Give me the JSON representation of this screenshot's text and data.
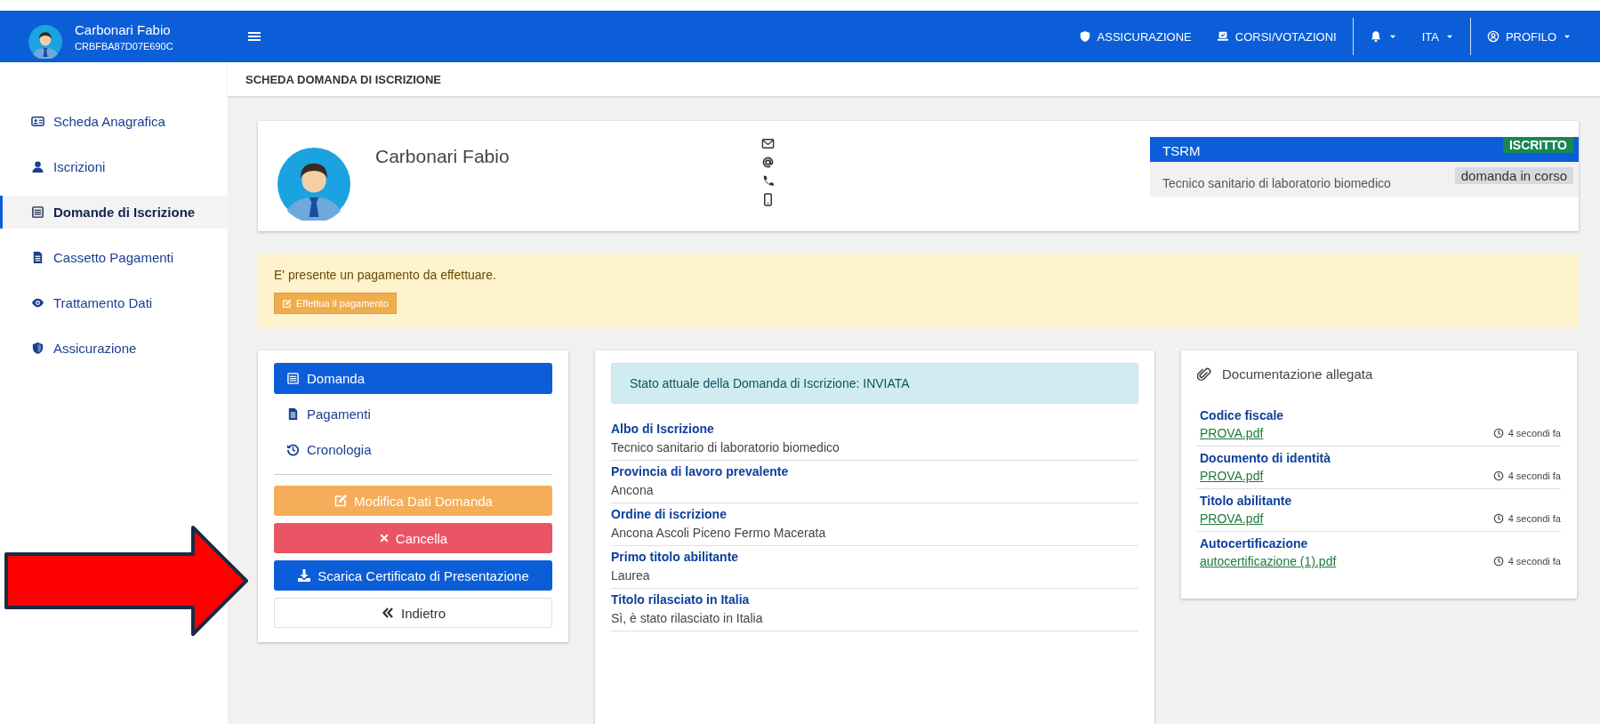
{
  "sidebar": {
    "user": {
      "name": "Carbonari Fabio",
      "code": "CRBFBA87D07E690C"
    },
    "items": [
      {
        "label": "Scheda Anagrafica",
        "selected": false
      },
      {
        "label": "Iscrizioni",
        "selected": false
      },
      {
        "label": "Domande di Iscrizione",
        "selected": true
      },
      {
        "label": "Cassetto Pagamenti",
        "selected": false
      },
      {
        "label": "Trattamento Dati",
        "selected": false
      },
      {
        "label": "Assicurazione",
        "selected": false
      }
    ]
  },
  "topbar": {
    "groups": [
      [
        {
          "label": "ASSICURAZIONE",
          "kind": "link"
        },
        {
          "label": "CORSI/VOTAZIONI",
          "kind": "link"
        }
      ],
      [
        {
          "kind": "dropdown"
        },
        {
          "label": "ITA",
          "kind": "dropdown"
        }
      ],
      [
        {
          "label": "PROFILO",
          "kind": "dropdown"
        }
      ]
    ]
  },
  "page_title": "SCHEDA DOMANDA DI ISCRIZIONE",
  "profile": {
    "name": "Carbonari Fabio",
    "registration": {
      "title": "TSRM",
      "status": "ISCRITTO",
      "profession": "Tecnico sanitario di laboratorio biomedico",
      "state": "domanda in corso"
    }
  },
  "alert": {
    "text": "E' presente un pagamento da effettuare.",
    "button": "Effettua il pagamento"
  },
  "app_menu": {
    "items": [
      {
        "label": "Domanda",
        "selected": true
      },
      {
        "label": "Pagamenti",
        "selected": false
      },
      {
        "label": "Cronologia",
        "selected": false
      }
    ],
    "actions": [
      {
        "label": "Modifica Dati Domanda",
        "kind": "edit"
      },
      {
        "label": "Cancella",
        "kind": "delete"
      },
      {
        "label": "Scarica Certificato di Presentazione",
        "kind": "download"
      },
      {
        "label": "Indietro",
        "kind": "back"
      }
    ]
  },
  "details": {
    "status": "Stato attuale della Domanda di Iscrizione: INVIATA",
    "fields": [
      {
        "label": "Albo di Iscrizione",
        "value": "Tecnico sanitario di laboratorio biomedico"
      },
      {
        "label": "Provincia di lavoro prevalente",
        "value": "Ancona"
      },
      {
        "label": "Ordine di iscrizione",
        "value": "Ancona Ascoli Piceno Fermo Macerata"
      },
      {
        "label": "Primo titolo abilitante",
        "value": "Laurea"
      },
      {
        "label": "Titolo rilasciato in Italia",
        "value": "Sì, è stato rilasciato in Italia"
      }
    ]
  },
  "documents": {
    "title": "Documentazione allegata",
    "items": [
      {
        "label": "Codice fiscale",
        "file": "PROVA.pdf",
        "time": "4 secondi fa"
      },
      {
        "label": "Documento di identità",
        "file": "PROVA.pdf",
        "time": "4 secondi fa"
      },
      {
        "label": "Titolo abilitante",
        "file": "PROVA.pdf",
        "time": "4 secondi fa"
      },
      {
        "label": "Autocertificazione",
        "file": "autocertificazione (1).pdf",
        "time": "4 secondi fa"
      }
    ]
  }
}
